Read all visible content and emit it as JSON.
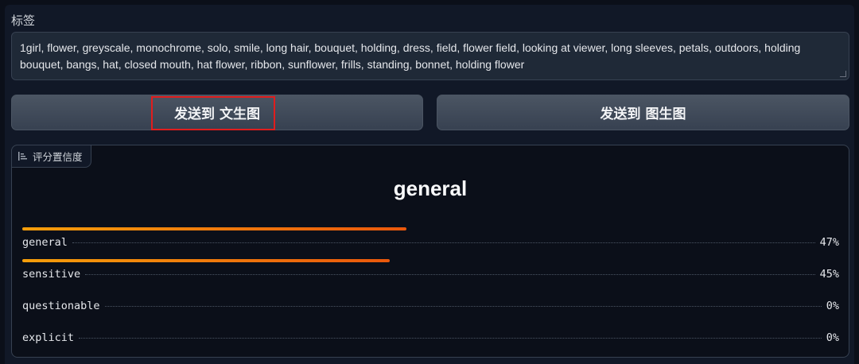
{
  "tags": {
    "label": "标签",
    "value": "1girl, flower, greyscale, monochrome, solo, smile, long hair, bouquet, holding, dress, field, flower field, looking at viewer, long sleeves, petals, outdoors, holding bouquet, bangs, hat, closed mouth, hat flower, ribbon, sunflower, frills, standing, bonnet, holding flower"
  },
  "buttons": {
    "send_txt2img": "发送到 文生图",
    "send_img2img": "发送到 图生图"
  },
  "confidence": {
    "tab_label": "评分置信度",
    "top_label": "general",
    "accent_color": "#ea580c",
    "rows": [
      {
        "label": "general",
        "value": "47%",
        "fraction": 0.47
      },
      {
        "label": "sensitive",
        "value": "45%",
        "fraction": 0.45
      },
      {
        "label": "questionable",
        "value": "0%",
        "fraction": 0.0
      },
      {
        "label": "explicit",
        "value": "0%",
        "fraction": 0.0
      }
    ]
  }
}
